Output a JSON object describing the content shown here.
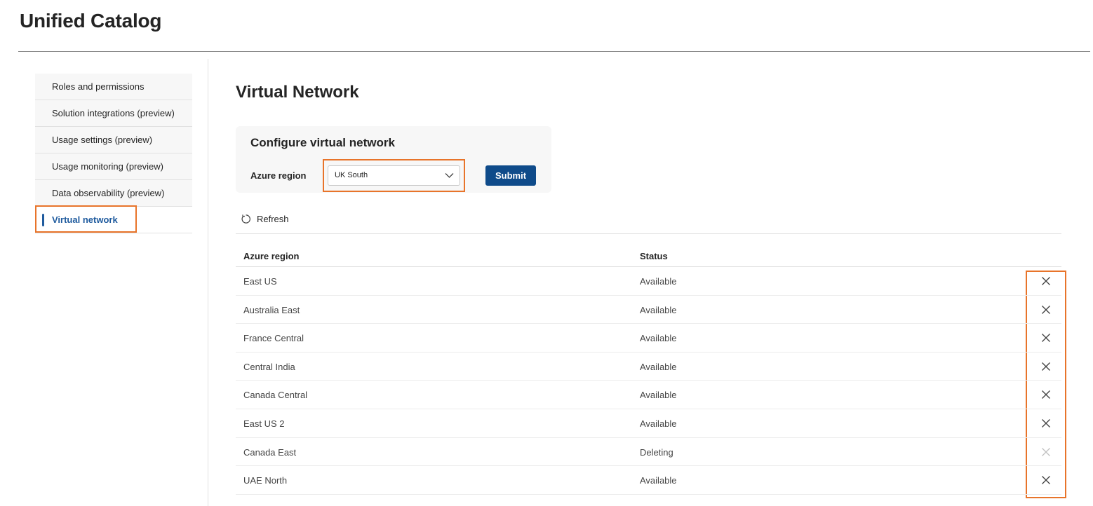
{
  "app": {
    "title": "Unified Catalog"
  },
  "sidebar": {
    "items": [
      {
        "label": "Roles and permissions",
        "active": false
      },
      {
        "label": "Solution integrations (preview)",
        "active": false
      },
      {
        "label": "Usage settings (preview)",
        "active": false
      },
      {
        "label": "Usage monitoring (preview)",
        "active": false
      },
      {
        "label": "Data observability (preview)",
        "active": false
      },
      {
        "label": "Virtual network",
        "active": true
      }
    ]
  },
  "main": {
    "title": "Virtual Network",
    "config": {
      "title": "Configure virtual network",
      "region_label": "Azure region",
      "region_value": "UK South",
      "submit_label": "Submit"
    },
    "toolbar": {
      "refresh_label": "Refresh"
    },
    "table": {
      "columns": [
        "Azure region",
        "Status"
      ],
      "rows": [
        {
          "region": "East US",
          "status": "Available",
          "delete_enabled": true
        },
        {
          "region": "Australia East",
          "status": "Available",
          "delete_enabled": true
        },
        {
          "region": "France Central",
          "status": "Available",
          "delete_enabled": true
        },
        {
          "region": "Central India",
          "status": "Available",
          "delete_enabled": true
        },
        {
          "region": "Canada Central",
          "status": "Available",
          "delete_enabled": true
        },
        {
          "region": "East US 2",
          "status": "Available",
          "delete_enabled": true
        },
        {
          "region": "Canada East",
          "status": "Deleting",
          "delete_enabled": false
        },
        {
          "region": "UAE North",
          "status": "Available",
          "delete_enabled": true
        }
      ]
    }
  },
  "colors": {
    "accent": "#0f4b8a",
    "active_nav": "#1f5b9e",
    "highlight": "#e8742a",
    "icon_enabled": "#424242",
    "icon_disabled": "#c2c2c2"
  },
  "icons": {
    "refresh": "refresh-icon",
    "dropdown": "chevron-down-icon",
    "delete": "close-icon"
  }
}
